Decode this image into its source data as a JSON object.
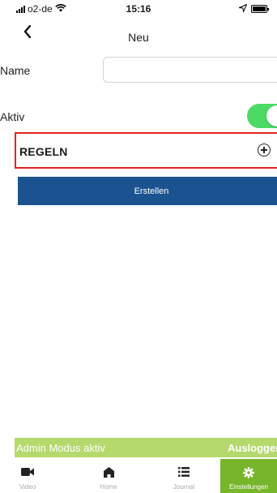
{
  "status_bar": {
    "carrier": "o2-de",
    "time": "15:16",
    "battery_level": 1.0,
    "signal_icon": "signal-bars-icon",
    "wifi_icon": "wifi-icon",
    "location_icon": "location-arrow-icon"
  },
  "nav": {
    "back_icon": "chevron-left-icon",
    "title": "Neu"
  },
  "form": {
    "name_label": "Name",
    "name_value": "",
    "aktiv_label": "Aktiv",
    "aktiv_on": true,
    "rules_label": "REGELN",
    "add_rule_icon": "plus-circle-icon",
    "create_button": "Erstellen"
  },
  "admin_banner": {
    "text": "Admin Modus aktiv",
    "logout": "Ausloggen"
  },
  "tabbar": {
    "items": [
      {
        "label": "Video",
        "icon": "video-camera-icon",
        "active": false
      },
      {
        "label": "Home",
        "icon": "home-icon",
        "active": false
      },
      {
        "label": "Journal",
        "icon": "list-icon",
        "active": false
      },
      {
        "label": "Einstellungen",
        "icon": "gear-icon",
        "active": true
      }
    ]
  },
  "colors": {
    "accent_blue": "#1b5390",
    "toggle_green": "#4cd964",
    "highlight_red": "#e32222",
    "admin_green": "#b5d96c",
    "tab_active_green": "#77b52a"
  }
}
